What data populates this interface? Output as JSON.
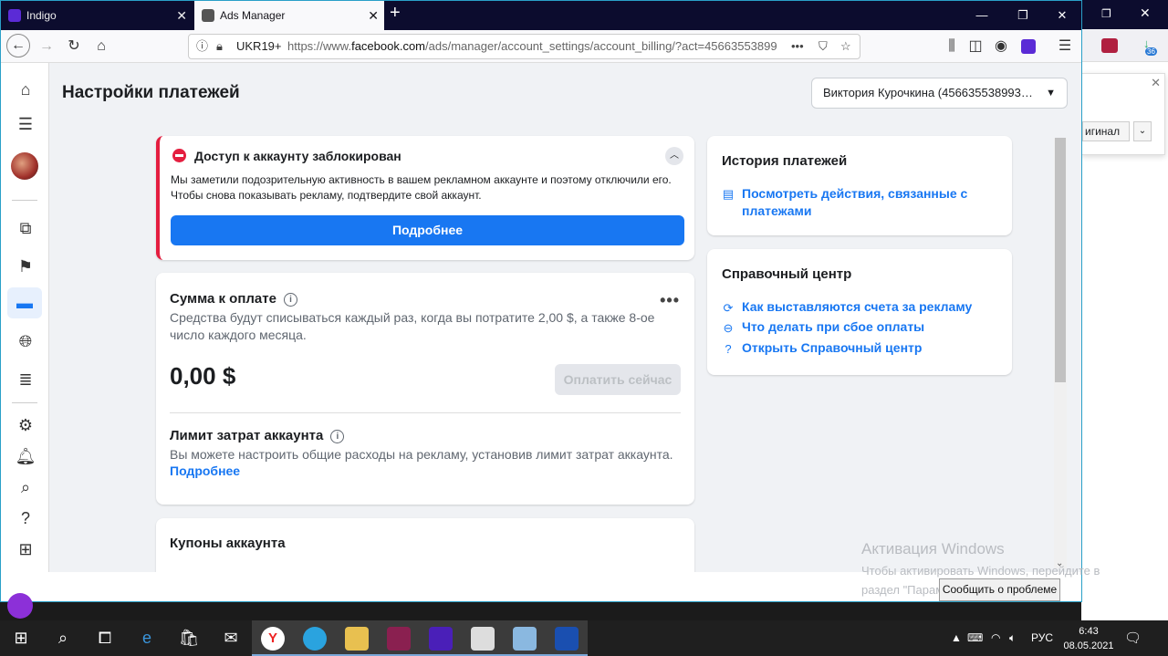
{
  "browser": {
    "tabs": [
      {
        "label": "Indigo"
      },
      {
        "label": "Ads Manager"
      }
    ],
    "url_prefix": "UKR19+",
    "url_host": "https://www.",
    "url_domain": "facebook.com",
    "url_path": "/ads/manager/account_settings/account_billing/?act=45663553899",
    "url_more": "•••"
  },
  "page": {
    "title": "Настройки платежей",
    "account_selector": "Виктория Курочкина (456635538993…"
  },
  "alert": {
    "title": "Доступ к аккаунту заблокирован",
    "body": "Мы заметили подозрительную активность в вашем рекламном аккаунте и поэтому отключили его. Чтобы снова показывать рекламу, подтвердите свой аккаунт.",
    "button": "Подробнее"
  },
  "payment": {
    "title": "Сумма к оплате",
    "description": "Средства будут списываться каждый раз, когда вы потратите 2,00 $, а также 8-ое число каждого месяца.",
    "amount": "0,00 $",
    "pay_now": "Оплатить сейчас",
    "limit_title": "Лимит затрат аккаунта",
    "limit_description": "Вы можете настроить общие расходы на рекламу, установив лимит затрат аккаунта.",
    "limit_link": "Подробнее",
    "more": "•••"
  },
  "coupons": {
    "title": "Купоны аккаунта"
  },
  "history": {
    "title": "История платежей",
    "link": "Посмотреть действия, связанные с платежами"
  },
  "help": {
    "title": "Справочный центр",
    "links": [
      "Как выставляются счета за рекламу",
      "Что делать при сбое оплаты",
      "Открыть Справочный центр"
    ]
  },
  "background_window": {
    "dropdown_text": "игинал"
  },
  "watermark": {
    "title": "Активация Windows",
    "body": "Чтобы активировать Windows, перейдите в раздел \"Параметры\".",
    "report_button": "Сообщить о проблеме"
  },
  "taskbar": {
    "language": "РУС",
    "time": "6:43",
    "date": "08.05.2021",
    "download_badge": "36"
  },
  "colors": {
    "accent": "#1877f2",
    "error": "#e41e3f",
    "tabbar": "#0c0c2e"
  }
}
